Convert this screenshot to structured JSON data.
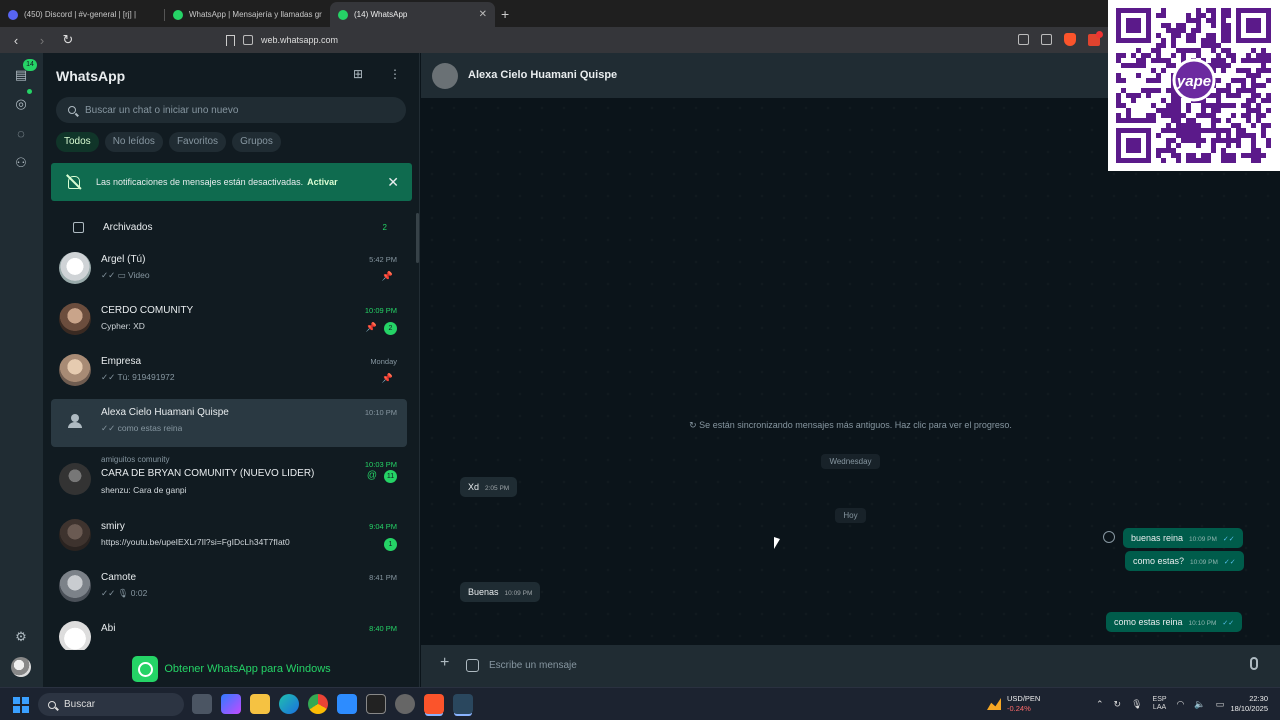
{
  "browser": {
    "tabs": [
      {
        "title": "(450) Discord | #v-general | [rj] |",
        "favicon_color": "#5865f2",
        "active": false
      },
      {
        "title": "WhatsApp | Mensajería y llamadas gr",
        "favicon_color": "#25d366",
        "active": false
      },
      {
        "title": "(14) WhatsApp",
        "favicon_color": "#25d366",
        "active": true
      }
    ],
    "new_tab": "+",
    "url": "web.whatsapp.com"
  },
  "rail": {
    "chats_badge": "14"
  },
  "sidebar": {
    "title": "WhatsApp",
    "search_placeholder": "Buscar un chat o iniciar uno nuevo",
    "filters": [
      "Todos",
      "No leídos",
      "Favoritos",
      "Grupos"
    ],
    "notification": {
      "text": "Las notificaciones de mensajes están desactivadas.",
      "action": "Activar"
    },
    "archived": {
      "label": "Archivados",
      "count": "2"
    },
    "chats": [
      {
        "name": "Argel (Tú)",
        "preview": "✓✓ ▭ Video",
        "time": "5:42 PM",
        "pinned": true
      },
      {
        "name": "CERDO COMUNITY",
        "preview": "Cypher: XD",
        "time": "10:09 PM",
        "unread": "2",
        "pinned": true
      },
      {
        "name": "Empresa",
        "preview": "✓✓ Tú: 919491972",
        "time": "Monday",
        "pinned": true
      },
      {
        "name": "Alexa Cielo Huamani Quispe",
        "preview": "✓✓ como estas reina",
        "time": "10:10 PM",
        "selected": true
      },
      {
        "group": "amiguitos comunity",
        "name": "CARA DE BRYAN COMUNITY (NUEVO LIDER)",
        "preview": "shenzu: Cara de ganpi",
        "time": "10:03 PM",
        "unread": "11",
        "mention": "@"
      },
      {
        "name": "smiry",
        "preview": "https://youtu.be/upeIEXLr7Il?si=FgIDcLh34T7fIat0",
        "time": "9:04 PM",
        "unread": "1"
      },
      {
        "name": "Camote",
        "preview": "✓✓ 🎙 0:02",
        "time": "8:41 PM"
      },
      {
        "name": "Abi",
        "preview": "",
        "time": "8:40 PM"
      }
    ],
    "get_app": "Obtener WhatsApp para Windows"
  },
  "conversation": {
    "contact": "Alexa Cielo Huamani Quispe",
    "sync_notice": "↻ Se están sincronizando mensajes más antiguos. Haz clic para ver el progreso.",
    "messages": [
      {
        "type": "divider",
        "text": "Wednesday"
      },
      {
        "type": "in",
        "text": "Xd",
        "time": "2:05 PM"
      },
      {
        "type": "divider",
        "text": "Hoy"
      },
      {
        "type": "out",
        "text": "buenas reina",
        "time": "10:09 PM"
      },
      {
        "type": "out",
        "text": "como estas?",
        "time": "10:09 PM"
      },
      {
        "type": "in",
        "text": "Buenas",
        "time": "10:09 PM"
      },
      {
        "type": "out",
        "text": "como estas reina",
        "time": "10:10 PM"
      }
    ],
    "composer_placeholder": "Escribe un mensaje"
  },
  "overlay": {
    "qr_brand": "yape"
  },
  "taskbar": {
    "search": "Buscar",
    "fx": {
      "pair": "USD/PEN",
      "change": "-0.24%"
    },
    "lang": {
      "line1": "ESP",
      "line2": "LAA"
    },
    "clock": {
      "time": "22:30",
      "date": "18/10/2025"
    }
  }
}
